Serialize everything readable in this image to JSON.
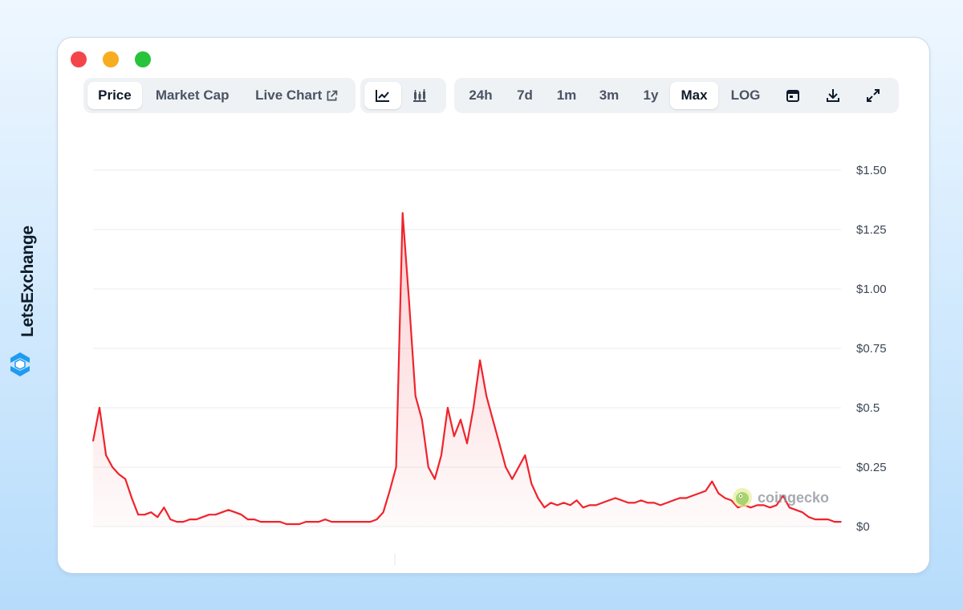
{
  "brand": {
    "name": "LetsExchange"
  },
  "toolbar": {
    "view_tabs": [
      {
        "label": "Price",
        "active": true
      },
      {
        "label": "Market Cap",
        "active": false
      },
      {
        "label": "Live Chart",
        "active": false,
        "icon": "external-link-icon"
      }
    ],
    "chart_type_buttons": [
      {
        "icon": "line-chart-icon",
        "active": true
      },
      {
        "icon": "candlestick-chart-icon",
        "active": false
      }
    ],
    "range_tabs": [
      {
        "label": "24h",
        "active": false
      },
      {
        "label": "7d",
        "active": false
      },
      {
        "label": "1m",
        "active": false
      },
      {
        "label": "3m",
        "active": false
      },
      {
        "label": "1y",
        "active": false
      },
      {
        "label": "Max",
        "active": true
      },
      {
        "label": "LOG",
        "active": false
      }
    ],
    "action_icons": [
      "calendar-icon",
      "download-icon",
      "expand-icon"
    ]
  },
  "watermark": {
    "text": "coingecko"
  },
  "colors": {
    "line": "#f0232c",
    "fill": "#fde7e8",
    "grid": "#e9ecf0",
    "active_tab_bg": "#ffffff",
    "tab_group_bg": "#eff2f5"
  },
  "chart_data": {
    "type": "area",
    "title": "",
    "xlabel": "",
    "ylabel": "",
    "ylim": [
      0,
      1.5
    ],
    "y_ticks": [
      "$0",
      "$0.25",
      "$0.5",
      "$0.75",
      "$1.00",
      "$1.25",
      "$1.50"
    ],
    "y_tick_values": [
      0,
      0.25,
      0.5,
      0.75,
      1.0,
      1.25,
      1.5
    ],
    "grid": true,
    "legend": "none",
    "series": [
      {
        "values": [
          0.36,
          0.5,
          0.3,
          0.25,
          0.22,
          0.2,
          0.12,
          0.05,
          0.05,
          0.06,
          0.04,
          0.08,
          0.03,
          0.02,
          0.02,
          0.03,
          0.03,
          0.04,
          0.05,
          0.05,
          0.06,
          0.07,
          0.06,
          0.05,
          0.03,
          0.03,
          0.02,
          0.02,
          0.02,
          0.02,
          0.01,
          0.01,
          0.01,
          0.02,
          0.02,
          0.02,
          0.03,
          0.02,
          0.02,
          0.02,
          0.02,
          0.02,
          0.02,
          0.02,
          0.03,
          0.06,
          0.15,
          0.25,
          1.32,
          0.95,
          0.55,
          0.45,
          0.25,
          0.2,
          0.3,
          0.5,
          0.38,
          0.45,
          0.35,
          0.5,
          0.7,
          0.55,
          0.45,
          0.35,
          0.25,
          0.2,
          0.25,
          0.3,
          0.18,
          0.12,
          0.08,
          0.1,
          0.09,
          0.1,
          0.09,
          0.11,
          0.08,
          0.09,
          0.09,
          0.1,
          0.11,
          0.12,
          0.11,
          0.1,
          0.1,
          0.11,
          0.1,
          0.1,
          0.09,
          0.1,
          0.11,
          0.12,
          0.12,
          0.13,
          0.14,
          0.15,
          0.19,
          0.14,
          0.12,
          0.11,
          0.08,
          0.09,
          0.08,
          0.09,
          0.09,
          0.08,
          0.09,
          0.13,
          0.08,
          0.07,
          0.06,
          0.04,
          0.03,
          0.03,
          0.03,
          0.02,
          0.02
        ]
      }
    ]
  }
}
